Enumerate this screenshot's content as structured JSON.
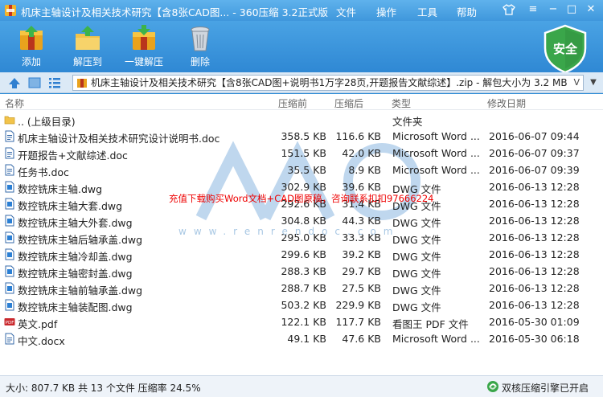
{
  "window": {
    "title": "机床主轴设计及相关技术研究【含8张CAD图... - 360压缩 3.2正式版",
    "menu": [
      "文件",
      "操作",
      "工具",
      "帮助"
    ]
  },
  "toolbar": {
    "add": "添加",
    "extract_to": "解压到",
    "one_click_extract": "一键解压",
    "delete": "删除",
    "safe_badge": "安全"
  },
  "addressbar": {
    "path": "机床主轴设计及相关技术研究【含8张CAD图+说明书1万字28页,开题报告文献综述】.zip - 解包大小为 3.2 MB"
  },
  "columns": {
    "name": "名称",
    "size": "压缩前",
    "packed": "压缩后",
    "type": "类型",
    "modified": "修改日期"
  },
  "files": [
    {
      "name": ".. (上级目录)",
      "size": "",
      "packed": "",
      "type": "文件夹",
      "date": "",
      "icon": "folder-icon"
    },
    {
      "name": "机床主轴设计及相关技术研究设计说明书.doc",
      "size": "358.5 KB",
      "packed": "116.6 KB",
      "type": "Microsoft Word ...",
      "date": "2016-06-07 09:44",
      "icon": "doc-icon"
    },
    {
      "name": "开题报告+文献综述.doc",
      "size": "151.5 KB",
      "packed": "42.0 KB",
      "type": "Microsoft Word ...",
      "date": "2016-06-07 09:37",
      "icon": "doc-icon"
    },
    {
      "name": "任务书.doc",
      "size": "35.5 KB",
      "packed": "8.9 KB",
      "type": "Microsoft Word ...",
      "date": "2016-06-07 09:39",
      "icon": "doc-icon"
    },
    {
      "name": "数控铣床主轴.dwg",
      "size": "302.9 KB",
      "packed": "39.6 KB",
      "type": "DWG 文件",
      "date": "2016-06-13 12:28",
      "icon": "dwg-icon"
    },
    {
      "name": "数控铣床主轴大套.dwg",
      "size": "292.6 KB",
      "packed": "31.4 KB",
      "type": "DWG 文件",
      "date": "2016-06-13 12:28",
      "icon": "dwg-icon"
    },
    {
      "name": "数控铣床主轴大外套.dwg",
      "size": "304.8 KB",
      "packed": "44.3 KB",
      "type": "DWG 文件",
      "date": "2016-06-13 12:28",
      "icon": "dwg-icon"
    },
    {
      "name": "数控铣床主轴后轴承盖.dwg",
      "size": "295.0 KB",
      "packed": "33.3 KB",
      "type": "DWG 文件",
      "date": "2016-06-13 12:28",
      "icon": "dwg-icon"
    },
    {
      "name": "数控铣床主轴冷却盖.dwg",
      "size": "299.6 KB",
      "packed": "39.2 KB",
      "type": "DWG 文件",
      "date": "2016-06-13 12:28",
      "icon": "dwg-icon"
    },
    {
      "name": "数控铣床主轴密封盖.dwg",
      "size": "288.3 KB",
      "packed": "29.7 KB",
      "type": "DWG 文件",
      "date": "2016-06-13 12:28",
      "icon": "dwg-icon"
    },
    {
      "name": "数控铣床主轴前轴承盖.dwg",
      "size": "288.7 KB",
      "packed": "27.5 KB",
      "type": "DWG 文件",
      "date": "2016-06-13 12:28",
      "icon": "dwg-icon"
    },
    {
      "name": "数控铣床主轴装配图.dwg",
      "size": "503.2 KB",
      "packed": "229.9 KB",
      "type": "DWG 文件",
      "date": "2016-06-13 12:28",
      "icon": "dwg-icon"
    },
    {
      "name": "英文.pdf",
      "size": "122.1 KB",
      "packed": "117.7 KB",
      "type": "看图王 PDF 文件",
      "date": "2016-05-30 01:09",
      "icon": "pdf-icon"
    },
    {
      "name": "中文.docx",
      "size": "49.1 KB",
      "packed": "47.6 KB",
      "type": "Microsoft Word ...",
      "date": "2016-05-30 06:18",
      "icon": "doc-icon"
    }
  ],
  "overlay": {
    "promo": "充值下载购买Word文档+CAD图原稿，咨询联系扣扣97666224",
    "watermark_url": "www.renrendoc.com"
  },
  "statusbar": {
    "summary": "大小: 807.7 KB 共 13 个文件 压缩率 24.5%",
    "engine": "双核压缩引擎已开启"
  },
  "colors": {
    "titlebar": "#4aa3e4",
    "selection": "#cce4f7",
    "safe_badge": "#3aa64a",
    "promo_text": "#e00000"
  }
}
